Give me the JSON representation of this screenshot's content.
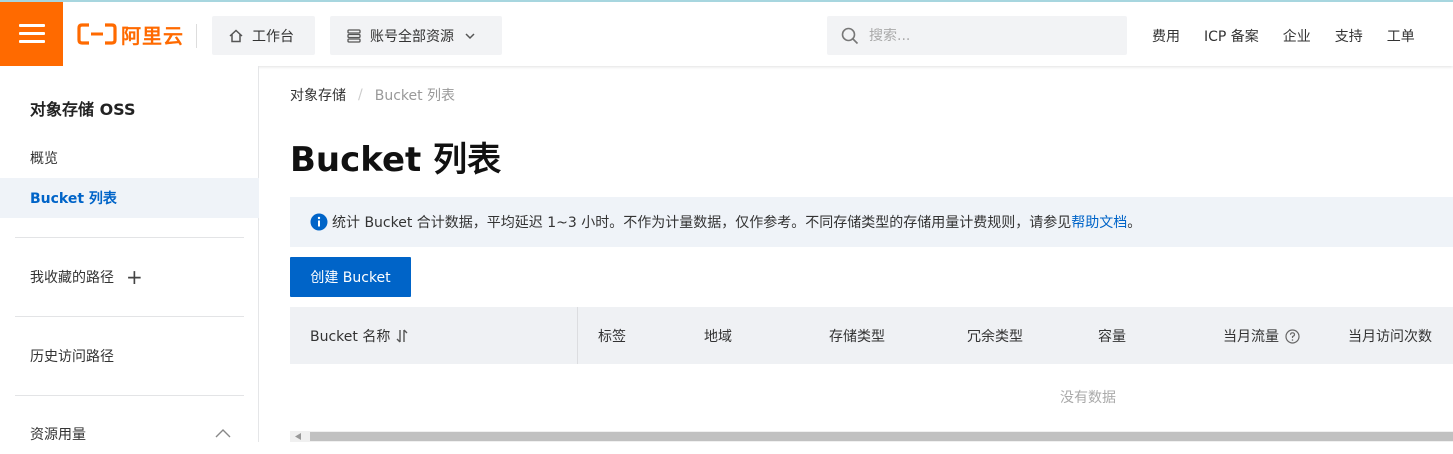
{
  "colors": {
    "brand": "#ff6a00",
    "primary": "#0064c8",
    "active_bg": "#eff3f8"
  },
  "header": {
    "logo_text": "阿里云",
    "workbench_label": "工作台",
    "resources_label": "账号全部资源",
    "search_placeholder": "搜索...",
    "nav": [
      "费用",
      "ICP 备案",
      "企业",
      "支持",
      "工单"
    ]
  },
  "sidebar": {
    "title": "对象存储 OSS",
    "items": {
      "overview": "概览",
      "bucket_list": "Bucket 列表",
      "favorites": "我收藏的路径",
      "history": "历史访问路径",
      "usage": "资源用量"
    }
  },
  "main": {
    "breadcrumb": [
      "对象存储",
      "Bucket 列表"
    ],
    "title": "Bucket 列表",
    "notice": {
      "text": "统计 Bucket 合计数据，平均延迟 1~3 小时。不作为计量数据，仅作参考。不同存储类型的存储用量计费规则，请参见",
      "link": "帮助文档",
      "suffix": "。"
    },
    "create_button": "创建 Bucket",
    "table": {
      "columns": [
        "Bucket 名称",
        "标签",
        "地域",
        "存储类型",
        "冗余类型",
        "容量",
        "当月流量",
        "当月访问次数"
      ],
      "empty_text": "没有数据"
    }
  }
}
